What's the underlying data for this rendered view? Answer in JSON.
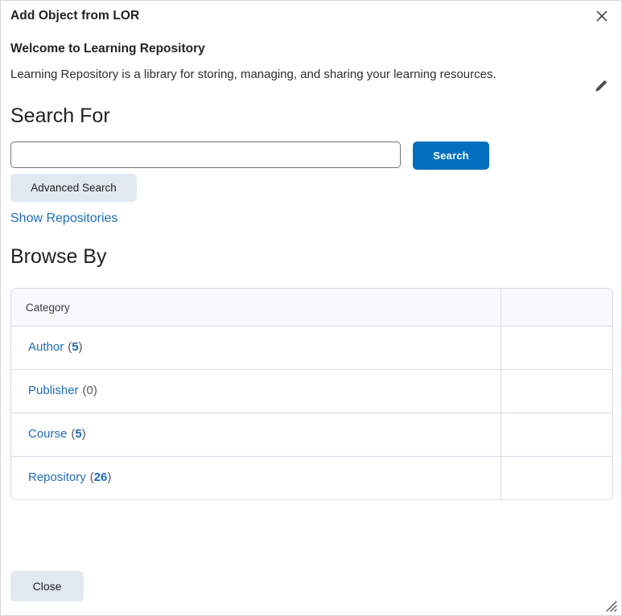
{
  "dialog": {
    "title": "Add Object from LOR",
    "close_icon": "close-icon"
  },
  "welcome": {
    "heading": "Welcome to Learning Repository",
    "text": "Learning Repository is a library for storing, managing, and sharing your learning resources.",
    "edit_icon": "pencil-icon"
  },
  "search": {
    "heading": "Search For",
    "input_value": "",
    "input_placeholder": "",
    "search_button": "Search",
    "advanced_search_button": "Advanced Search",
    "show_repositories_link": "Show Repositories"
  },
  "browse": {
    "heading": "Browse By",
    "columns": [
      "Category",
      ""
    ],
    "rows": [
      {
        "label": "Author",
        "count": "5",
        "open": "(",
        "close": ")",
        "zero": false
      },
      {
        "label": "Publisher",
        "count": "0",
        "open": "(",
        "close": ")",
        "zero": true
      },
      {
        "label": "Course",
        "count": "5",
        "open": "(",
        "close": ")",
        "zero": false
      },
      {
        "label": "Repository",
        "count": "26",
        "open": "(",
        "close": ")",
        "zero": false
      }
    ]
  },
  "footer": {
    "close_button": "Close",
    "resize_grip_icon": "resize-grip-icon"
  },
  "colors": {
    "accent_blue": "#006fbf",
    "link_blue": "#1f6bb8",
    "button_grey": "#e2e8f0",
    "table_header_bg": "#f7f9fc",
    "table_border": "#d3dce6"
  }
}
